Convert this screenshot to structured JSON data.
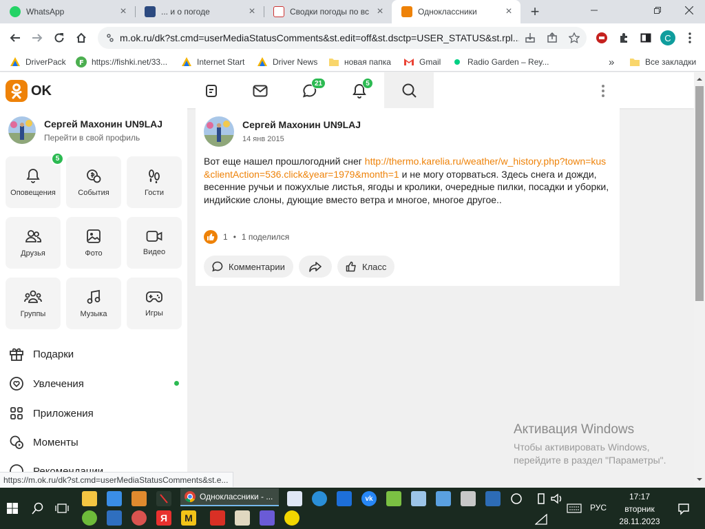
{
  "browser": {
    "tabs": [
      {
        "title": "WhatsApp",
        "active": false
      },
      {
        "title": "... и о погоде",
        "active": false
      },
      {
        "title": "Сводки погоды по вс",
        "active": false
      },
      {
        "title": "Одноклассники",
        "active": true
      }
    ],
    "new_tab_label": "+",
    "url": "m.ok.ru/dk?st.cmd=userMediaStatusComments&st.edit=off&st.dsctp=USER_STATUS&st.rpl...",
    "profile_initial": "C",
    "bookmarks": [
      {
        "label": "DriverPack",
        "icon": "driverpack-icon"
      },
      {
        "label": "https://fishki.net/33...",
        "icon": "fishki-icon"
      },
      {
        "label": "Internet Start",
        "icon": "driverpack-icon"
      },
      {
        "label": "Driver News",
        "icon": "driverpack-icon"
      },
      {
        "label": "новая папка",
        "icon": "folder-icon"
      },
      {
        "label": "Gmail",
        "icon": "gmail-icon"
      },
      {
        "label": "Radio Garden – Rey...",
        "icon": "radio-icon"
      }
    ],
    "bookmarks_overflow": "»",
    "all_bookmarks": "Все закладки",
    "status_url": "https://m.ok.ru/dk?st.cmd=userMediaStatusComments&st.e..."
  },
  "ok": {
    "logo_text": "OK",
    "header_badges": {
      "messages": "21",
      "notifications": "5"
    },
    "profile": {
      "name": "Сергей Махонин UN9LAJ",
      "subtitle": "Перейти в свой профиль"
    },
    "tiles": [
      {
        "label": "Оповещения",
        "icon": "bell-icon",
        "badge": "5"
      },
      {
        "label": "События",
        "icon": "events-icon"
      },
      {
        "label": "Гости",
        "icon": "footprints-icon"
      },
      {
        "label": "Друзья",
        "icon": "friends-icon"
      },
      {
        "label": "Фото",
        "icon": "photo-icon"
      },
      {
        "label": "Видео",
        "icon": "video-icon"
      },
      {
        "label": "Группы",
        "icon": "groups-icon"
      },
      {
        "label": "Музыка",
        "icon": "music-icon"
      },
      {
        "label": "Игры",
        "icon": "gamepad-icon"
      }
    ],
    "menu": [
      {
        "label": "Подарки",
        "icon": "gift-icon"
      },
      {
        "label": "Увлечения",
        "icon": "heart-circle-icon",
        "dot": true
      },
      {
        "label": "Приложения",
        "icon": "apps-icon"
      },
      {
        "label": "Моменты",
        "icon": "moments-icon"
      },
      {
        "label": "Рекомендации",
        "icon": "recommend-icon"
      }
    ],
    "post": {
      "author": "Сергей Махонин UN9LAJ",
      "date": "14 янв 2015",
      "text_before": "Вот еще нашел прошлогодний снег ",
      "link": "http://thermo.karelia.ru/weather/w_history.php?town=kus&clientAction=536.click&year=1979&month=1",
      "text_after": " и не могу оторваться. Здесь снега и дожди, весенние ручьи и пожухлые листья, ягоды и кролики, очередные пилки, посадки и уборки, индийские слоны, дующие вместо ветра и многое, многое другое..",
      "likes": "1",
      "separator": "•",
      "shares": "1 поделился",
      "buttons": {
        "comments": "Комментарии",
        "like": "Класс"
      }
    }
  },
  "windows": {
    "watermark_title": "Активация Windows",
    "watermark_text": "Чтобы активировать Windows, перейдите в раздел \"Параметры\".",
    "taskbar_active_app": "Одноклассники - ...",
    "language": "РУС",
    "time": "17:17",
    "weekday": "вторник",
    "date": "28.11.2023"
  },
  "colors": {
    "ok_orange": "#ee8208",
    "badge_green": "#2cba52",
    "taskbar": "#1a2a20"
  }
}
